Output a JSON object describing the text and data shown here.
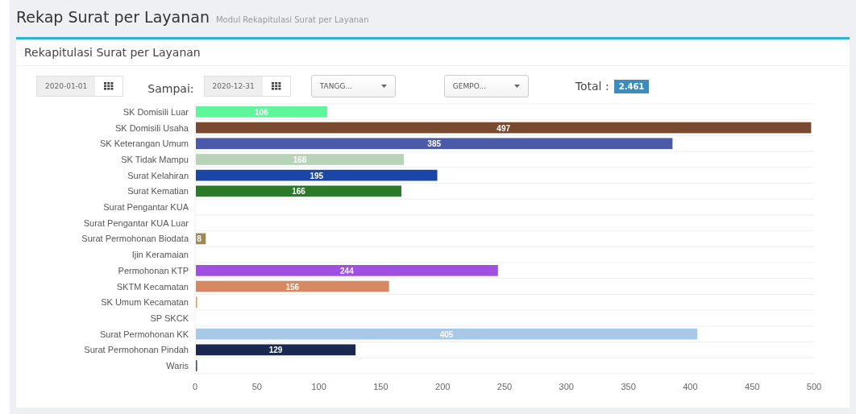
{
  "page": {
    "title": "Rekap Surat per Layanan",
    "subtitle": "Modul Rekapitulasi Surat per Layanan"
  },
  "card": {
    "title": "Rekapitulasi Surat per Layanan"
  },
  "filters": {
    "start_date": "2020-01-01",
    "until_label": "Sampai:",
    "end_date": "2020-12-31",
    "dropdowns": [
      "TANGG...",
      "GEMPO..."
    ],
    "total_label": "Total :",
    "total": "2.461"
  },
  "chart_data": {
    "type": "bar",
    "orientation": "horizontal",
    "categories": [
      "SK Domisili Luar",
      "SK Domisili Usaha",
      "SK Keterangan Umum",
      "SK Tidak Mampu",
      "Surat Kelahiran",
      "Surat Kematian",
      "Surat Pengantar KUA",
      "Surat Pengantar KUA Luar",
      "Surat Permohonan Biodata",
      "Ijin Keramaian",
      "Permohonan KTP",
      "SKTM Kecamatan",
      "SK Umum Kecamatan",
      "SP SKCK",
      "Surat Permohonan KK",
      "Surat Permohonan Pindah",
      "Waris"
    ],
    "values": [
      106,
      497,
      385,
      168,
      195,
      166,
      0,
      0,
      8,
      0,
      244,
      156,
      1,
      0,
      405,
      129,
      1
    ],
    "colors": [
      "#5ef59b",
      "#7a4a30",
      "#4a5aa8",
      "#b8d4b8",
      "#1a46a8",
      "#2a7a2a",
      null,
      null,
      "#a08858",
      null,
      "#a050e0",
      "#d88860",
      "#e0a040",
      null,
      "#a8c8e8",
      "#1a2850",
      "#404860"
    ],
    "value_labels": [
      "106",
      "497",
      "385",
      "168",
      "195",
      "166",
      null,
      null,
      "8",
      null,
      "244",
      "156",
      null,
      null,
      "405",
      "129",
      null
    ],
    "xlim": [
      0,
      500
    ],
    "xticks": [
      0,
      50,
      100,
      150,
      200,
      250,
      300,
      350,
      400,
      450,
      500
    ]
  }
}
